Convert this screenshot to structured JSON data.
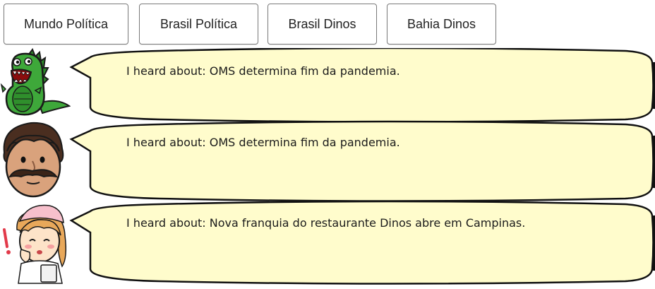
{
  "tabs": [
    {
      "label": "Mundo Política"
    },
    {
      "label": "Brasil Política"
    },
    {
      "label": "Brasil Dinos"
    },
    {
      "label": "Bahia Dinos"
    }
  ],
  "messages": [
    {
      "avatar": "dinosaur-icon",
      "text": "I heard about: OMS determina fim da pandemia."
    },
    {
      "avatar": "mustache-man-icon",
      "text": "I heard about: OMS determina fim da pandemia."
    },
    {
      "avatar": "nurse-icon",
      "text": "I heard about: Nova franquia do restaurante Dinos abre em Campinas."
    }
  ],
  "colors": {
    "bubble_fill": "#fffccc",
    "bubble_stroke": "#111111",
    "tab_border": "#7a7a7a",
    "dino_green": "#3ea83a"
  }
}
